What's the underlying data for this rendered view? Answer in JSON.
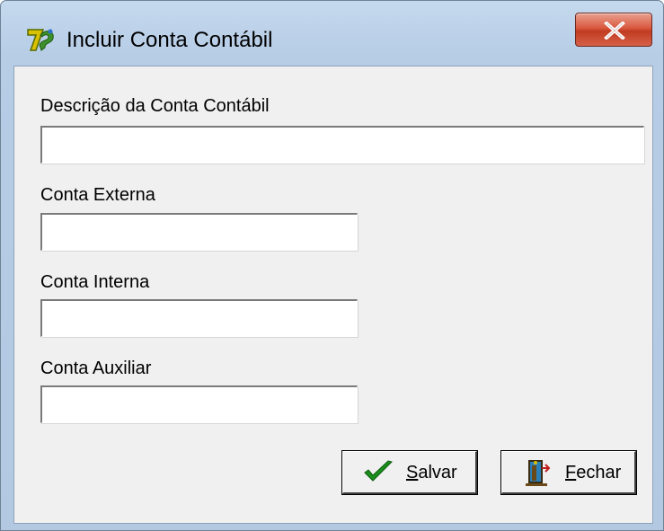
{
  "window": {
    "title": "Incluir Conta Contábil",
    "close_glyph": "x"
  },
  "form": {
    "descricao": {
      "label": "Descrição da Conta Contábil",
      "value": "",
      "placeholder": ""
    },
    "conta_externa": {
      "label": "Conta Externa",
      "value": "",
      "placeholder": ""
    },
    "conta_interna": {
      "label": "Conta Interna",
      "value": "",
      "placeholder": ""
    },
    "conta_auxiliar": {
      "label": "Conta Auxiliar",
      "value": "",
      "placeholder": ""
    }
  },
  "buttons": {
    "salvar": {
      "mnemonic": "S",
      "rest": "alvar",
      "icon": "checkmark-icon"
    },
    "fechar": {
      "mnemonic": "F",
      "rest": "echar",
      "icon": "exit-door-icon"
    }
  },
  "colors": {
    "titlebar": "#b7cde6",
    "client": "#f0f0f0",
    "close_button": "#c9452b",
    "check_green": "#1b8f1b"
  }
}
